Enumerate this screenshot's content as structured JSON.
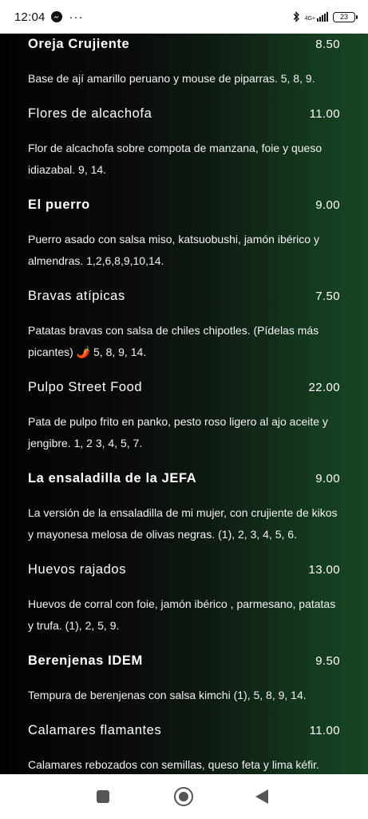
{
  "status_bar": {
    "time": "12:04",
    "messenger_icon": "messenger-icon",
    "more_notifications": "···",
    "bluetooth_icon": "bluetooth-icon",
    "network_label": "4G+",
    "battery": "23"
  },
  "menu": {
    "items": [
      {
        "name": "Oreja Crujiente",
        "bold": true,
        "price": "8.50",
        "description": "Base de ají amarillo peruano y mouse de piparras. 5, 8, 9."
      },
      {
        "name": "Flores de alcachofa",
        "bold": false,
        "price": "11.00",
        "description": "Flor de alcachofa sobre compota de manzana, foie y queso idiazabal. 9, 14."
      },
      {
        "name": "El puerro",
        "bold": true,
        "price": "9.00",
        "description": "Puerro asado con salsa miso, katsuobushi, jamón ibérico y almendras. 1,2,6,8,9,10,14."
      },
      {
        "name": "Bravas atípicas",
        "bold": false,
        "price": "7.50",
        "description": "Patatas bravas con salsa de chiles chipotles. (Pídelas más picantes) 🌶️ 5, 8, 9, 14."
      },
      {
        "name": "Pulpo Street Food",
        "bold": false,
        "price": "22.00",
        "description": "Pata de pulpo frito en panko, pesto roso ligero al ajo aceite y jengibre. 1, 2 3, 4, 5, 7."
      },
      {
        "name": "La ensaladilla de la JEFA",
        "bold": true,
        "price": "9.00",
        "description": "La versión de la ensaladilla de mi mujer, con crujiente de kikos y mayonesa melosa de olivas negras. (1), 2, 3, 4, 5, 6."
      },
      {
        "name": "Huevos rajados",
        "bold": false,
        "price": "13.00",
        "description": "Huevos de corral con foie, jamón ibérico , parmesano, patatas y trufa. (1), 2, 5, 9."
      },
      {
        "name": "Berenjenas IDEM",
        "bold": true,
        "price": "9.50",
        "description": "Tempura de berenjenas con salsa kimchi (1), 5, 8, 9, 14."
      },
      {
        "name": "Calamares flamantes",
        "bold": false,
        "price": "11.00",
        "description": "Calamares rebozados con semillas, queso feta y lima kéfir."
      }
    ]
  },
  "nav_bar": {
    "recent_icon": "recent-apps-icon",
    "home_icon": "home-icon",
    "back_icon": "back-icon"
  }
}
